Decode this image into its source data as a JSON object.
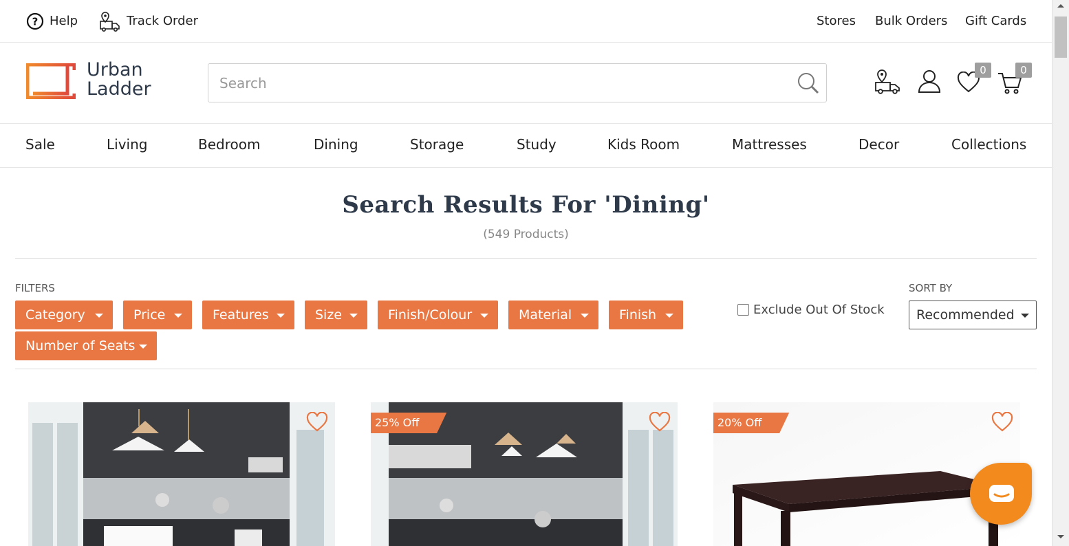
{
  "topbar": {
    "help_label": "Help",
    "track_order_label": "Track Order",
    "stores_label": "Stores",
    "bulk_orders_label": "Bulk Orders",
    "gift_cards_label": "Gift Cards"
  },
  "header": {
    "logo_line1": "Urban",
    "logo_line2": "Ladder",
    "search_placeholder": "Search",
    "wishlist_count": "0",
    "cart_count": "0"
  },
  "nav": {
    "items": [
      "Sale",
      "Living",
      "Bedroom",
      "Dining",
      "Storage",
      "Study",
      "Kids Room",
      "Mattresses",
      "Decor",
      "Collections"
    ]
  },
  "results": {
    "title": "Search Results For 'Dining'",
    "count": "(549 Products)"
  },
  "filters": {
    "label": "FILTERS",
    "buttons": [
      "Category",
      "Price",
      "Features",
      "Size",
      "Finish/Colour",
      "Material",
      "Finish",
      "Number of Seats"
    ],
    "exclude_label": "Exclude Out Of Stock"
  },
  "sort": {
    "label": "SORT BY",
    "selected": "Recommended"
  },
  "products": [
    {
      "discount": ""
    },
    {
      "discount": "25% Off"
    },
    {
      "discount": "20% Off"
    }
  ],
  "colors": {
    "accent": "#e87743",
    "text_dark": "#2e3a4a",
    "chat": "#f28a1e"
  }
}
